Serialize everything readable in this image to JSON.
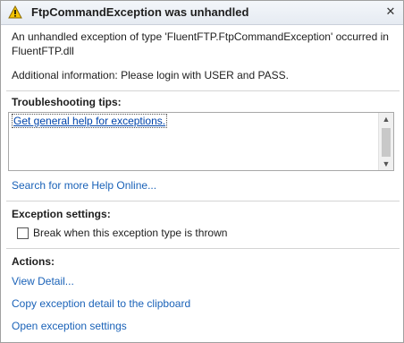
{
  "dialog": {
    "title": "FtpCommandException was unhandled",
    "summary": "An unhandled exception of type 'FluentFTP.FtpCommandException' occurred in FluentFTP.dll",
    "additional_info": "Additional information: Please login with USER and PASS."
  },
  "troubleshooting": {
    "heading": "Troubleshooting tips:",
    "tips": [
      "Get general help for exceptions."
    ],
    "search_link": "Search for more Help Online..."
  },
  "exception_settings": {
    "heading": "Exception settings:",
    "break_label": "Break when this exception type is thrown",
    "break_checked": false
  },
  "actions": {
    "heading": "Actions:",
    "items": [
      "View Detail...",
      "Copy exception detail to the clipboard",
      "Open exception settings"
    ]
  },
  "icons": {
    "warning": "warning-icon",
    "close": "close-icon"
  },
  "colors": {
    "link": "#1a62b8",
    "warning": "#f5c400"
  }
}
